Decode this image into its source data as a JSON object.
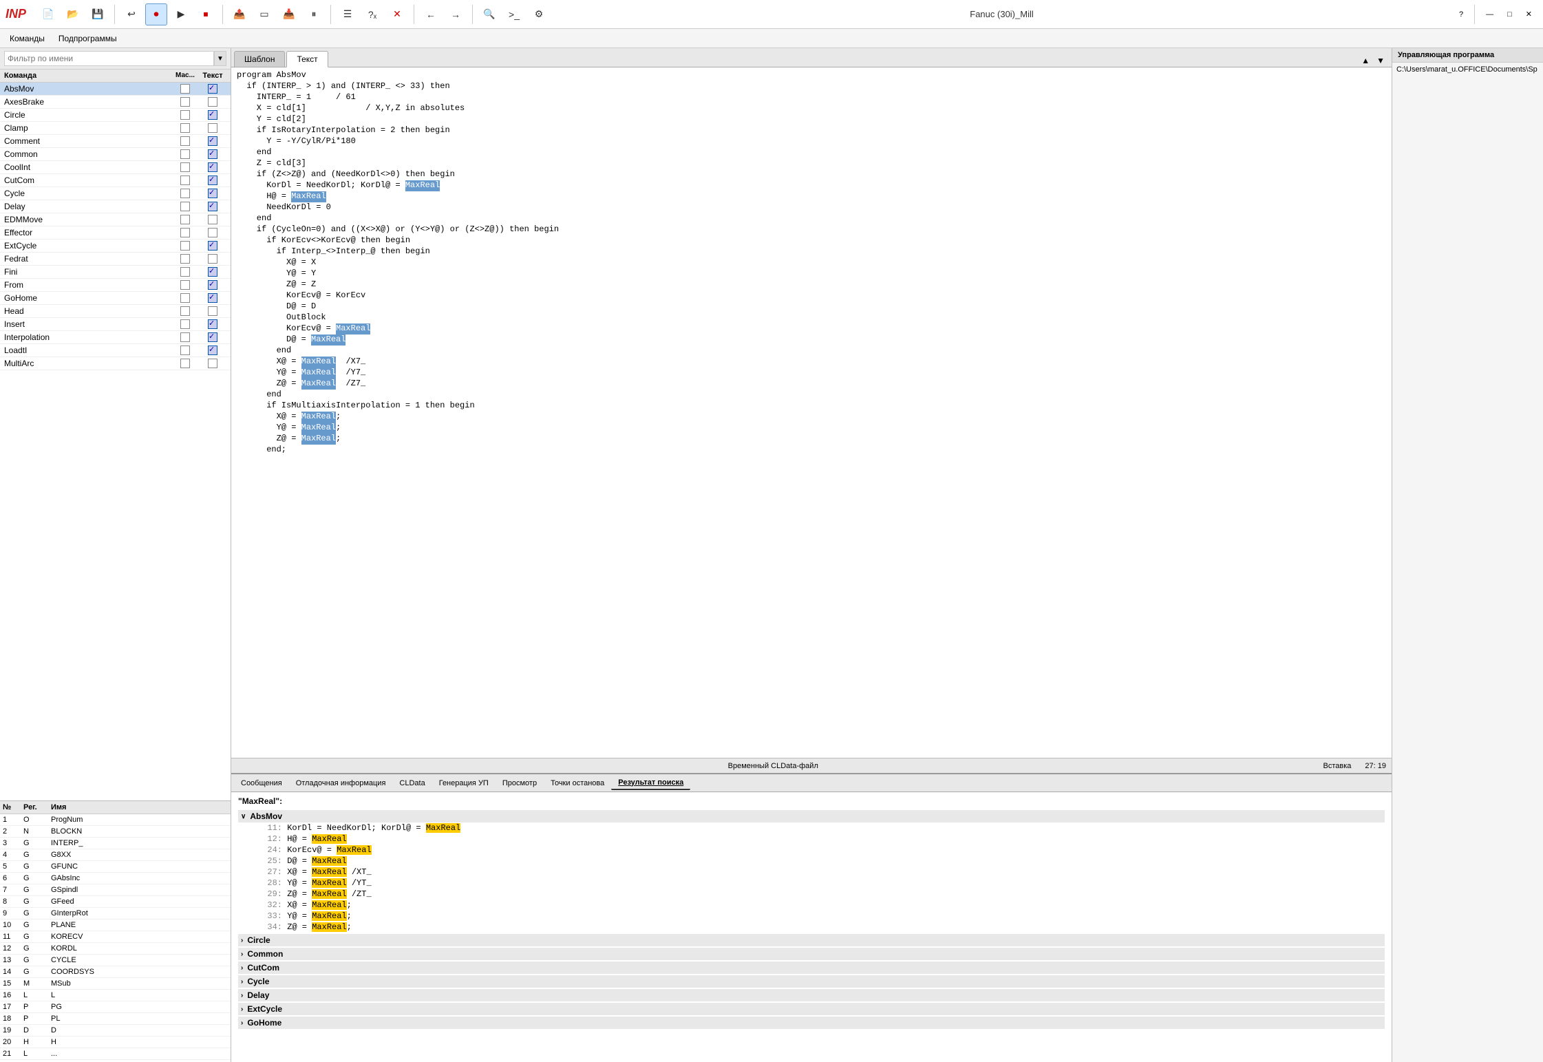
{
  "app": {
    "logo": "INP",
    "title": "Fanuc (30i)_Mill",
    "help_label": "?",
    "minimize": "—",
    "maximize": "□",
    "close": "✕"
  },
  "menubar": {
    "items": [
      "Команды",
      "Подпрограммы"
    ]
  },
  "toolbar": {
    "buttons": [
      {
        "id": "new",
        "icon": "📄",
        "label": "Новый"
      },
      {
        "id": "open",
        "icon": "📂",
        "label": "Открыть"
      },
      {
        "id": "save",
        "icon": "💾",
        "label": "Сохранить"
      },
      {
        "id": "undo",
        "icon": "↩",
        "label": "Отменить"
      },
      {
        "id": "record",
        "icon": "⏺",
        "label": "Запись"
      },
      {
        "id": "play",
        "icon": "▶",
        "label": "Воспроизвести"
      },
      {
        "id": "stop",
        "icon": "⏹",
        "label": "Стоп"
      },
      {
        "id": "export",
        "icon": "📤",
        "label": "Экспорт"
      },
      {
        "id": "frame",
        "icon": "▭",
        "label": "Фрейм"
      },
      {
        "id": "import",
        "icon": "📥",
        "label": "Импорт"
      },
      {
        "id": "pause",
        "icon": "⏸",
        "label": "Пауза"
      },
      {
        "id": "list",
        "icon": "☰",
        "label": "Список"
      },
      {
        "id": "syntax",
        "icon": "?ₓ",
        "label": "Синтаксис"
      },
      {
        "id": "cross",
        "icon": "✕",
        "label": "Закрыть"
      },
      {
        "id": "back",
        "icon": "←",
        "label": "Назад"
      },
      {
        "id": "fwd",
        "icon": "→",
        "label": "Вперёд"
      },
      {
        "id": "find",
        "icon": "🔍",
        "label": "Найти"
      },
      {
        "id": "cmd",
        "icon": ">_",
        "label": "Команда"
      },
      {
        "id": "settings",
        "icon": "⚙",
        "label": "Настройки"
      }
    ]
  },
  "filter": {
    "placeholder": "Фильтр по имени",
    "dropdown_arrow": "▼"
  },
  "commands_table": {
    "headers": [
      "Команда",
      "Мас...",
      "Текст"
    ],
    "rows": [
      {
        "name": "AbsMov",
        "mas": false,
        "text": true,
        "selected": true
      },
      {
        "name": "AxesBrake",
        "mas": false,
        "text": false
      },
      {
        "name": "Circle",
        "mas": false,
        "text": true
      },
      {
        "name": "Clamp",
        "mas": false,
        "text": false
      },
      {
        "name": "Comment",
        "mas": false,
        "text": true
      },
      {
        "name": "Common",
        "mas": false,
        "text": true
      },
      {
        "name": "CoolInt",
        "mas": false,
        "text": true
      },
      {
        "name": "CutCom",
        "mas": false,
        "text": true
      },
      {
        "name": "Cycle",
        "mas": false,
        "text": true
      },
      {
        "name": "Delay",
        "mas": false,
        "text": true
      },
      {
        "name": "EDMMove",
        "mas": false,
        "text": false
      },
      {
        "name": "Effector",
        "mas": false,
        "text": false
      },
      {
        "name": "ExtCycle",
        "mas": false,
        "text": true
      },
      {
        "name": "Fedrat",
        "mas": false,
        "text": false
      },
      {
        "name": "Fini",
        "mas": false,
        "text": true
      },
      {
        "name": "From",
        "mas": false,
        "text": true
      },
      {
        "name": "GoHome",
        "mas": false,
        "text": true
      },
      {
        "name": "Head",
        "mas": false,
        "text": false
      },
      {
        "name": "Insert",
        "mas": false,
        "text": true
      },
      {
        "name": "Interpolation",
        "mas": false,
        "text": true
      },
      {
        "name": "LoadtI",
        "mas": false,
        "text": true
      },
      {
        "name": "MultiArc",
        "mas": false,
        "text": false
      }
    ]
  },
  "var_table": {
    "headers": [
      "№",
      "Рег.",
      "Имя"
    ],
    "rows": [
      {
        "num": "1",
        "reg": "O",
        "name": "ProgNum"
      },
      {
        "num": "2",
        "reg": "N",
        "name": "BLOCKN"
      },
      {
        "num": "3",
        "reg": "G",
        "name": "INTERP_"
      },
      {
        "num": "4",
        "reg": "G",
        "name": "G8XX"
      },
      {
        "num": "5",
        "reg": "G",
        "name": "GFUNC"
      },
      {
        "num": "6",
        "reg": "G",
        "name": "GAbsInc"
      },
      {
        "num": "7",
        "reg": "G",
        "name": "GSpindl"
      },
      {
        "num": "8",
        "reg": "G",
        "name": "GFeed"
      },
      {
        "num": "9",
        "reg": "G",
        "name": "GInterpRot"
      },
      {
        "num": "10",
        "reg": "G",
        "name": "PLANE"
      },
      {
        "num": "11",
        "reg": "G",
        "name": "KORECV"
      },
      {
        "num": "12",
        "reg": "G",
        "name": "KORDL"
      },
      {
        "num": "13",
        "reg": "G",
        "name": "CYCLE"
      },
      {
        "num": "14",
        "reg": "G",
        "name": "COORDSYS"
      },
      {
        "num": "15",
        "reg": "M",
        "name": "MSub"
      },
      {
        "num": "16",
        "reg": "L",
        "name": "L"
      },
      {
        "num": "17",
        "reg": "P",
        "name": "PG"
      },
      {
        "num": "18",
        "reg": "P",
        "name": "PL"
      },
      {
        "num": "19",
        "reg": "D",
        "name": "D"
      },
      {
        "num": "20",
        "reg": "H",
        "name": "H"
      },
      {
        "num": "21",
        "reg": "L",
        "name": "..."
      }
    ]
  },
  "editor": {
    "tabs": [
      "Шаблон",
      "Текст"
    ],
    "active_tab": "Текст",
    "code_lines": [
      {
        "text": "program AbsMov"
      },
      {
        "text": "  if (INTERP_ > 1) and (INTERP_ <> 33) then"
      },
      {
        "text": "    INTERP_ = 1     / 61"
      },
      {
        "text": "    X = cld[1]            / X,Y,Z in absolutes"
      },
      {
        "text": "    Y = cld[2]"
      },
      {
        "text": "    if IsRotaryInterpolation = 2 then begin"
      },
      {
        "text": "      Y = -Y/CylR/Pi*180"
      },
      {
        "text": "    end"
      },
      {
        "text": "    Z = cld[3]"
      },
      {
        "text": "    if (Z<>Z@) and (NeedKorDl<>0) then begin"
      },
      {
        "text": "      KorDl = NeedKorDl; KorDl@ = MaxReal",
        "highlight": "MaxReal"
      },
      {
        "text": "      H@ = MaxReal"
      },
      {
        "text": "      NeedKorDl = 0"
      },
      {
        "text": "    end"
      },
      {
        "text": "    if (CycleOn=0) and ((X<>X@) or (Y<>Y@) or (Z<>Z@)) then begin"
      },
      {
        "text": "      if KorEcv<>KorEcv@ then begin"
      },
      {
        "text": "        if Interp_<>Interp_@ then begin"
      },
      {
        "text": "          X@ = X"
      },
      {
        "text": "          Y@ = Y"
      },
      {
        "text": "          Z@ = Z"
      },
      {
        "text": "          KorEcv@ = KorEcv"
      },
      {
        "text": "          D@ = D"
      },
      {
        "text": "          OutBlock"
      },
      {
        "text": "          KorEcv@ = MaxReal",
        "highlight": "MaxReal"
      },
      {
        "text": "          D@ = MaxReal",
        "highlight": "MaxReal"
      },
      {
        "text": "        end"
      },
      {
        "text": "        X@ = MaxReal  /X7_",
        "highlight": "MaxReal"
      },
      {
        "text": "        Y@ = MaxReal  /Y7_"
      },
      {
        "text": "        Z@ = MaxReal  /Z7_"
      },
      {
        "text": "      end"
      },
      {
        "text": "      if IsMultiaxisInterpolation = 1 then begin"
      },
      {
        "text": "        X@ = MaxReal;"
      },
      {
        "text": "        Y@ = MaxReal;"
      },
      {
        "text": "        Z@ = MaxReal;"
      },
      {
        "text": "      end;"
      }
    ],
    "status": {
      "file": "Временный CLData-файл",
      "mode": "Вставка",
      "pos": "27:  19"
    }
  },
  "bottom_panel": {
    "tabs": [
      "Сообщения",
      "Отладочная информация",
      "CLData",
      "Генерация УП",
      "Просмотр",
      "Точки останова",
      "Результат поиска"
    ],
    "active_tab": "Результат поиска",
    "search_query": "\"MaxReal\":",
    "groups": [
      {
        "name": "AbsMov",
        "expanded": true,
        "results": [
          {
            "line": "11:",
            "text": "    KorDl = NeedKorDl; KorDl@ = MaxReal"
          },
          {
            "line": "12:",
            "text": "    H@ = MaxReal"
          },
          {
            "line": "24:",
            "text": "      KorEcv@ = MaxReal"
          },
          {
            "line": "25:",
            "text": "      D@ = MaxReal"
          },
          {
            "line": "27:",
            "text": "      X@ = MaxReal /XT_"
          },
          {
            "line": "28:",
            "text": "      Y@ = MaxReal /YT_"
          },
          {
            "line": "29:",
            "text": "      Z@ = MaxReal /ZT_"
          },
          {
            "line": "32:",
            "text": "      X@ = MaxReal;"
          },
          {
            "line": "33:",
            "text": "      Y@ = MaxReal;"
          },
          {
            "line": "34:",
            "text": "      Z@ = MaxReal;"
          }
        ]
      },
      {
        "name": "Circle",
        "expanded": false,
        "results": []
      },
      {
        "name": "Common",
        "expanded": false,
        "results": []
      },
      {
        "name": "CutCom",
        "expanded": false,
        "results": []
      },
      {
        "name": "Cycle",
        "expanded": false,
        "results": []
      },
      {
        "name": "Delay",
        "expanded": false,
        "results": []
      },
      {
        "name": "ExtCycle",
        "expanded": false,
        "results": []
      },
      {
        "name": "GoHome",
        "expanded": false,
        "results": []
      }
    ]
  },
  "right_sidebar": {
    "title": "Управляющая программа",
    "path": "C:\\Users\\marat_u.OFFICE\\Documents\\Sp"
  }
}
